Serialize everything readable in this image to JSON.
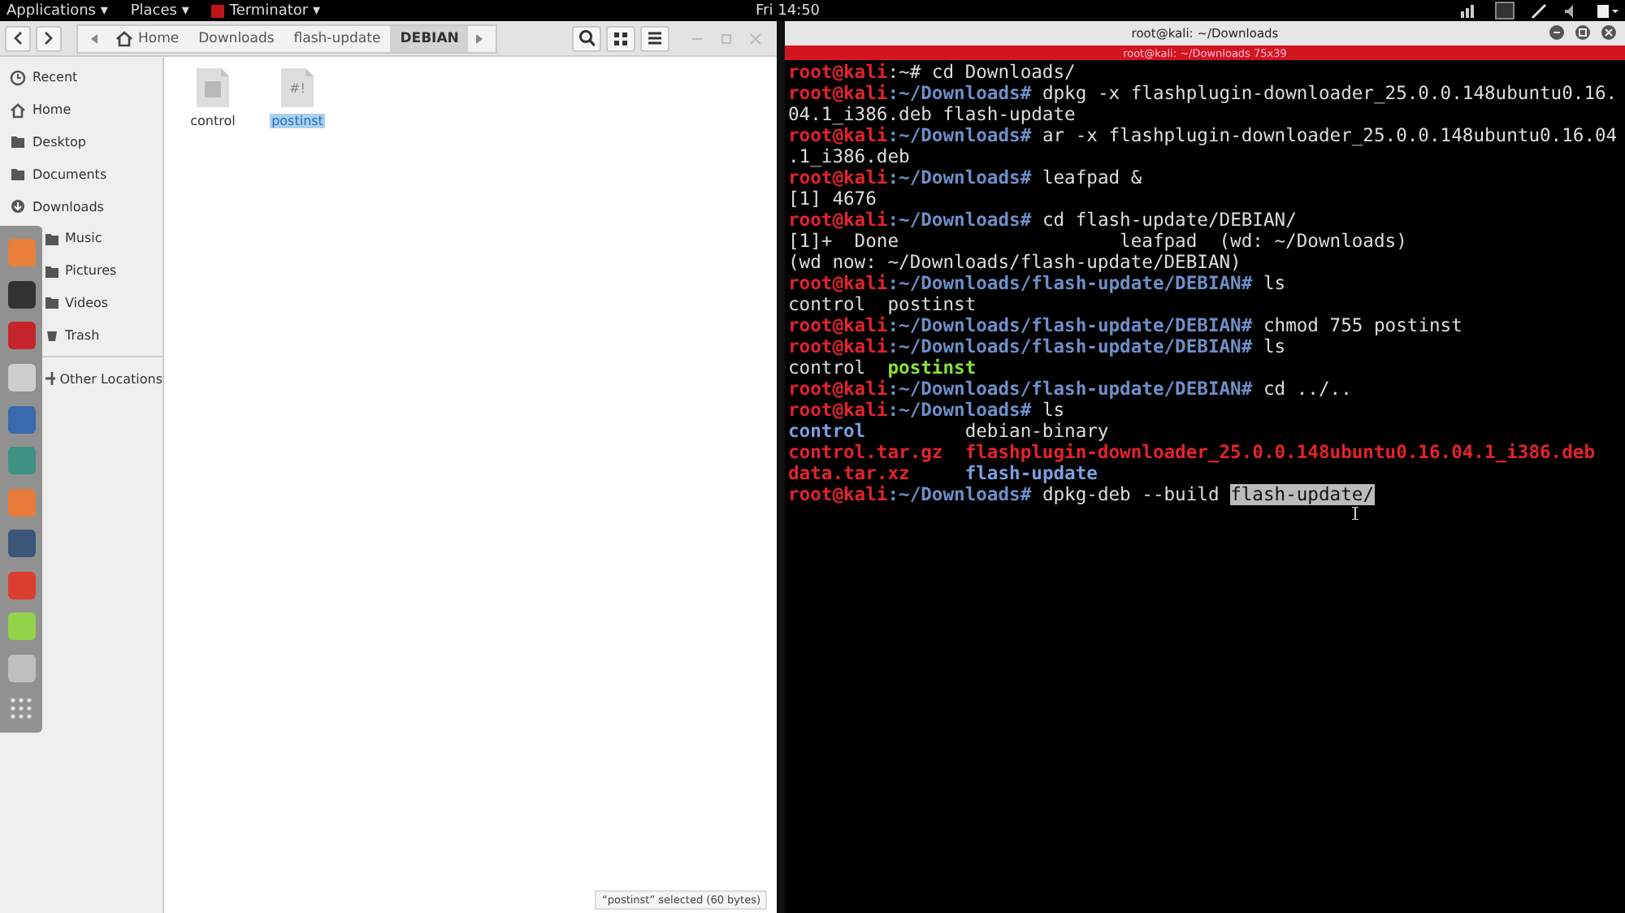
{
  "top_bar": {
    "menus": [
      {
        "label": "Applications",
        "arrow": "▾"
      },
      {
        "label": "Places",
        "arrow": "▾"
      },
      {
        "label": "Terminator",
        "arrow": "▾"
      }
    ],
    "clock": "Fri 14:50"
  },
  "files": {
    "path": [
      {
        "label": "Home",
        "selected": false
      },
      {
        "label": "Downloads",
        "selected": false
      },
      {
        "label": "flash-update",
        "selected": false
      },
      {
        "label": "DEBIAN",
        "selected": true
      }
    ],
    "sidebar": [
      {
        "label": "Recent"
      },
      {
        "label": "Home"
      },
      {
        "label": "Desktop"
      },
      {
        "label": "Documents"
      },
      {
        "label": "Downloads"
      },
      {
        "label": "Music"
      },
      {
        "label": "Pictures"
      },
      {
        "label": "Videos"
      },
      {
        "label": "Trash"
      },
      {
        "label": "Other Locations"
      }
    ],
    "items": [
      {
        "name": "control",
        "selected": false
      },
      {
        "name": "postinst",
        "glyph": "#!",
        "selected": true
      }
    ],
    "status": "“postinst” selected  (60 bytes)"
  },
  "terminal": {
    "title": "root@kali: ~/Downloads",
    "tab_title": "root@kali: ~/Downloads 75x39",
    "lines": [
      {
        "segments": [
          {
            "kind": "user",
            "text": "root@kali"
          },
          {
            "kind": "plain",
            "text": ":~# cd Downloads/"
          }
        ]
      },
      {
        "segments": [
          {
            "kind": "user",
            "text": "root@kali"
          },
          {
            "kind": "path",
            "text": ":~/Downloads#"
          },
          {
            "kind": "plain",
            "text": " dpkg -x flashplugin-downloader_25.0.0.148ubuntu0.16."
          }
        ]
      },
      {
        "segments": [
          {
            "kind": "plain",
            "text": "04.1_i386.deb flash-update"
          }
        ]
      },
      {
        "segments": [
          {
            "kind": "user",
            "text": "root@kali"
          },
          {
            "kind": "path",
            "text": ":~/Downloads#"
          },
          {
            "kind": "plain",
            "text": " ar -x flashplugin-downloader_25.0.0.148ubuntu0.16.04"
          }
        ]
      },
      {
        "segments": [
          {
            "kind": "plain",
            "text": ".1_i386.deb"
          }
        ]
      },
      {
        "segments": [
          {
            "kind": "user",
            "text": "root@kali"
          },
          {
            "kind": "path",
            "text": ":~/Downloads#"
          },
          {
            "kind": "plain",
            "text": " leafpad &"
          }
        ]
      },
      {
        "segments": [
          {
            "kind": "plain",
            "text": "[1] 4676"
          }
        ]
      },
      {
        "segments": [
          {
            "kind": "user",
            "text": "root@kali"
          },
          {
            "kind": "path",
            "text": ":~/Downloads#"
          },
          {
            "kind": "plain",
            "text": " cd flash-update/DEBIAN/"
          }
        ]
      },
      {
        "segments": [
          {
            "kind": "plain",
            "text": "[1]+  Done                    leafpad  (wd: ~/Downloads)"
          }
        ]
      },
      {
        "segments": [
          {
            "kind": "plain",
            "text": "(wd now: ~/Downloads/flash-update/DEBIAN)"
          }
        ]
      },
      {
        "segments": [
          {
            "kind": "user",
            "text": "root@kali"
          },
          {
            "kind": "path",
            "text": ":~/Downloads/flash-update/DEBIAN#"
          },
          {
            "kind": "plain",
            "text": " ls"
          }
        ]
      },
      {
        "segments": [
          {
            "kind": "plain",
            "text": "control  postinst"
          }
        ]
      },
      {
        "segments": [
          {
            "kind": "user",
            "text": "root@kali"
          },
          {
            "kind": "path",
            "text": ":~/Downloads/flash-update/DEBIAN#"
          },
          {
            "kind": "plain",
            "text": " chmod 755 postinst"
          }
        ]
      },
      {
        "segments": [
          {
            "kind": "user",
            "text": "root@kali"
          },
          {
            "kind": "path",
            "text": ":~/Downloads/flash-update/DEBIAN#"
          },
          {
            "kind": "plain",
            "text": " ls"
          }
        ]
      },
      {
        "segments": [
          {
            "kind": "plain",
            "text": "control  "
          },
          {
            "kind": "exec",
            "text": "postinst"
          }
        ]
      },
      {
        "segments": [
          {
            "kind": "user",
            "text": "root@kali"
          },
          {
            "kind": "path",
            "text": ":~/Downloads/flash-update/DEBIAN#"
          },
          {
            "kind": "plain",
            "text": " cd ../.."
          }
        ]
      },
      {
        "segments": [
          {
            "kind": "user",
            "text": "root@kali"
          },
          {
            "kind": "path",
            "text": ":~/Downloads#"
          },
          {
            "kind": "plain",
            "text": " ls"
          }
        ]
      },
      {
        "segments": [
          {
            "kind": "dir",
            "text": "control"
          },
          {
            "kind": "plain",
            "text": "         debian-binary"
          }
        ]
      },
      {
        "segments": [
          {
            "kind": "archive",
            "text": "control.tar.gz"
          },
          {
            "kind": "archive",
            "text": "  flashplugin-downloader_25.0.0.148ubuntu0.16.04.1_i386.deb"
          }
        ]
      },
      {
        "segments": [
          {
            "kind": "archive",
            "text": "data.tar.xz"
          },
          {
            "kind": "dir",
            "text": "     flash-update"
          }
        ]
      },
      {
        "segments": [
          {
            "kind": "user",
            "text": "root@kali"
          },
          {
            "kind": "path",
            "text": ":~/Downloads#"
          },
          {
            "kind": "plain",
            "text": " dpkg-deb --build "
          },
          {
            "kind": "selection",
            "text": "flash-update/"
          }
        ]
      }
    ]
  }
}
